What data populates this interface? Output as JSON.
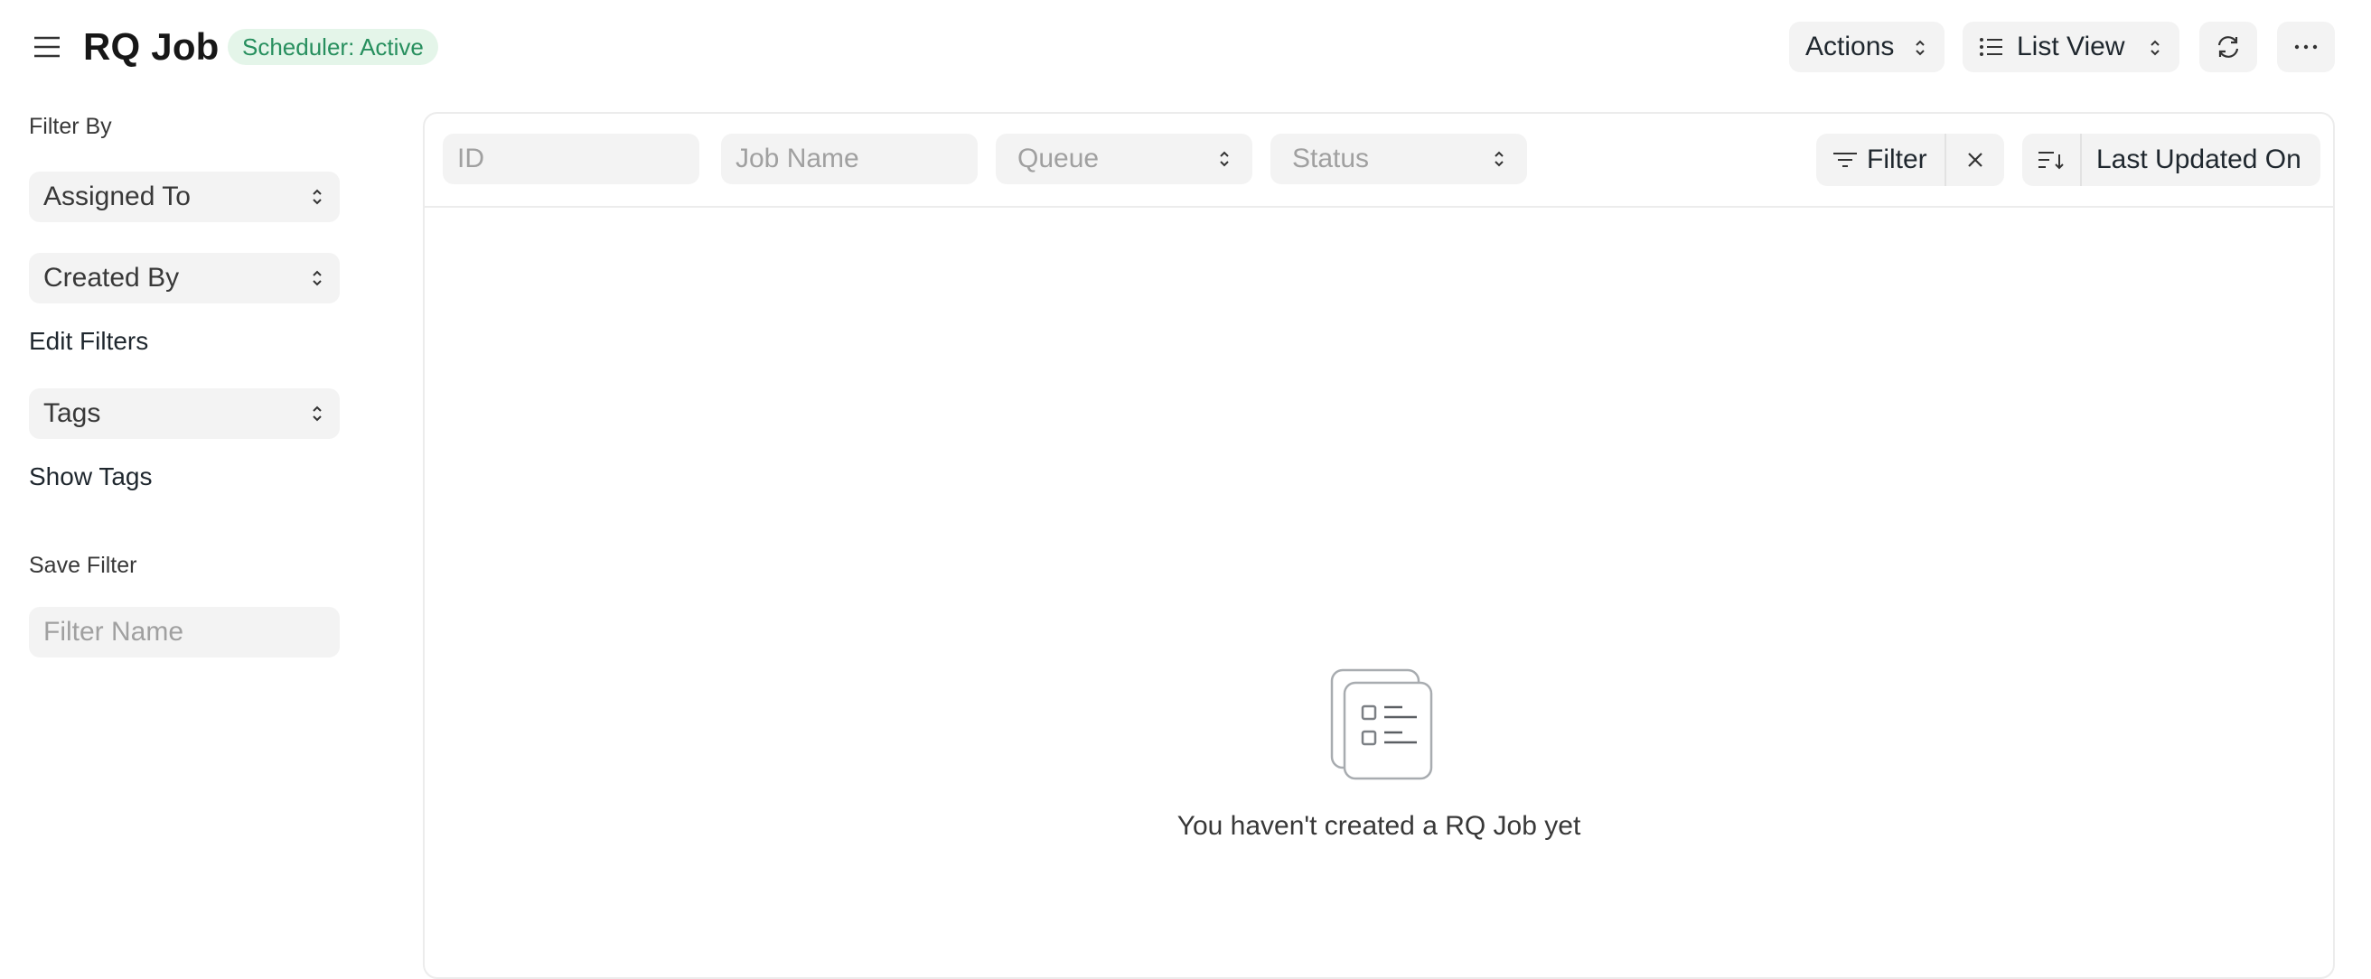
{
  "header": {
    "title": "RQ Job",
    "scheduler_badge": "Scheduler: Active",
    "actions_label": "Actions",
    "list_view_label": "List View",
    "refresh_icon": "refresh-icon",
    "more_icon": "ellipsis-icon",
    "menu_icon": "hamburger-icon"
  },
  "sidebar": {
    "filter_by_label": "Filter By",
    "assigned_to": "Assigned To",
    "created_by": "Created By",
    "edit_filters": "Edit Filters",
    "tags": "Tags",
    "show_tags": "Show Tags",
    "save_filter_label": "Save Filter",
    "filter_name_placeholder": "Filter Name"
  },
  "filters": {
    "id_placeholder": "ID",
    "job_name_placeholder": "Job Name",
    "queue_placeholder": "Queue",
    "status_placeholder": "Status",
    "filter_label": "Filter",
    "sort_field": "Last Updated On"
  },
  "empty_state": {
    "message": "You haven't created a RQ Job yet"
  },
  "colors": {
    "badge_bg": "#e4f5e9",
    "badge_text": "#278f5e",
    "control_bg": "#f3f3f3",
    "border": "#ececec"
  }
}
